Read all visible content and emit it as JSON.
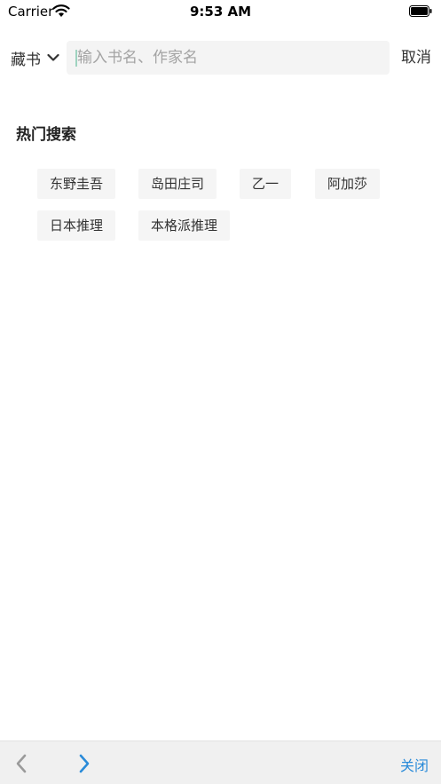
{
  "status_bar": {
    "carrier": "Carrier",
    "time": "9:53 AM"
  },
  "search": {
    "scope_label": "藏书",
    "placeholder": "输入书名、作家名",
    "value": "",
    "cancel_label": "取消"
  },
  "hot_search": {
    "title": "热门搜索",
    "tags": [
      "东野圭吾",
      "岛田庄司",
      "乙一",
      "阿加莎",
      "日本推理",
      "本格派推理"
    ]
  },
  "toolbar": {
    "back_icon": "chevron-left-icon",
    "forward_icon": "chevron-right-icon",
    "close_label": "关闭",
    "back_color": "#9a9a9a",
    "forward_color": "#2a8bd9"
  }
}
